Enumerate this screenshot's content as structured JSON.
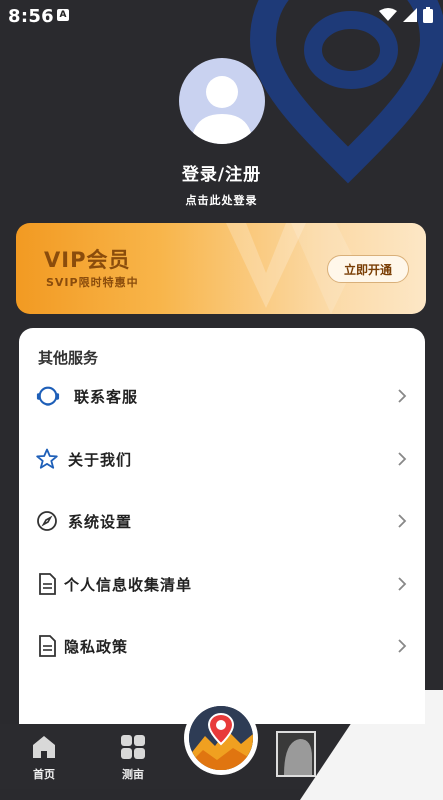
{
  "status": {
    "time": "8:56",
    "a_badge": "A"
  },
  "profile": {
    "title": "登录/注册",
    "subtitle": "点击此处登录"
  },
  "vip": {
    "title": "VIP会员",
    "subtitle": "SVIP限时特惠中",
    "button": "立即开通"
  },
  "services": {
    "title": "其他服务",
    "items": [
      {
        "label": "联系客服",
        "icon": "headset-icon"
      },
      {
        "label": "关于我们",
        "icon": "star-icon"
      },
      {
        "label": "系统设置",
        "icon": "compass-icon"
      },
      {
        "label": "个人信息收集清单",
        "icon": "document-icon"
      },
      {
        "label": "隐私政策",
        "icon": "document-icon"
      }
    ]
  },
  "nav": {
    "home": "首页",
    "measure": "测亩"
  },
  "colors": {
    "accent": "#f29a22",
    "bg": "#2a2a2e",
    "pin": "#1e3a78"
  }
}
